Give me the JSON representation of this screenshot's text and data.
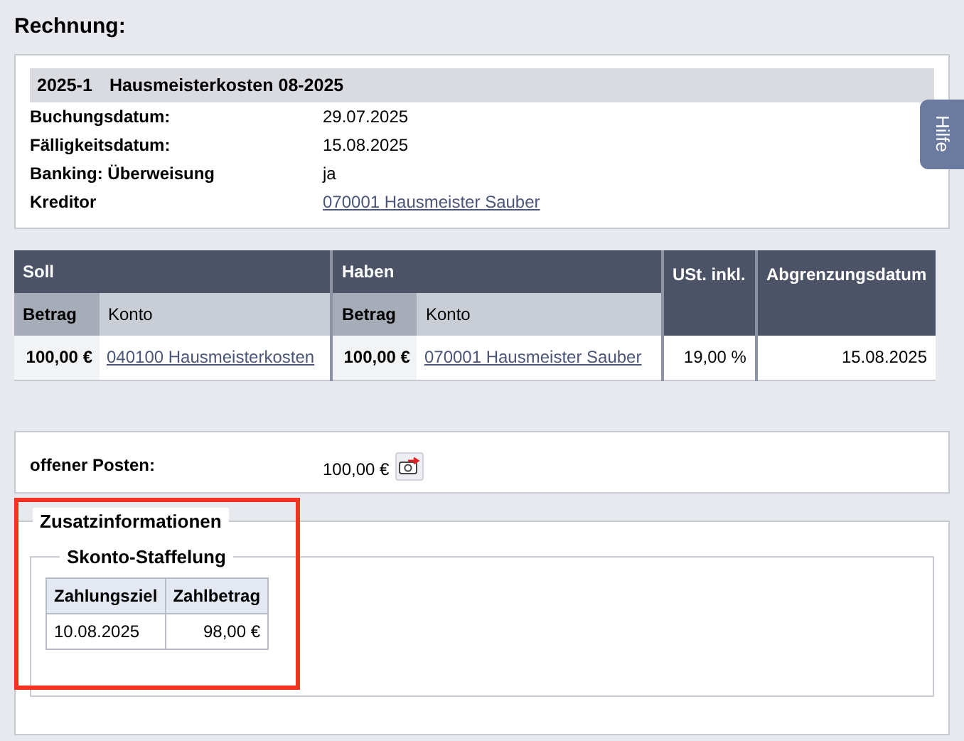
{
  "page_title": "Rechnung:",
  "invoice": {
    "title_number": "2025-1",
    "title_text": "Hausmeisterkosten 08-2025",
    "fields": [
      {
        "label": "Buchungsdatum:",
        "value": "29.07.2025",
        "kind": "text"
      },
      {
        "label": "Fälligkeitsdatum:",
        "value": "15.08.2025",
        "kind": "text"
      },
      {
        "label": "Banking: Überweisung",
        "value": "ja",
        "kind": "text"
      },
      {
        "label": "Kreditor",
        "value": "070001 Hausmeister Sauber",
        "kind": "link"
      }
    ]
  },
  "help_tab": "Hilfe",
  "booking_table": {
    "groups": [
      "Soll",
      "Haben",
      "USt. inkl.",
      "Abgrenzungsdatum"
    ],
    "subheaders": [
      "Betrag",
      "Konto",
      "Betrag",
      "Konto"
    ],
    "row": {
      "soll_betrag": "100,00 €",
      "soll_konto": "040100 Hausmeisterkosten",
      "haben_betrag": "100,00 €",
      "haben_konto": "070001 Hausmeister Sauber",
      "ust": "19,00 %",
      "abgrenzungsdatum": "15.08.2025"
    }
  },
  "open_item": {
    "label": "offener Posten:",
    "value": "100,00 €"
  },
  "additional_info": {
    "title": "Zusatzinformationen",
    "highlighted": true,
    "discount": {
      "title": "Skonto-Staffelung",
      "columns": [
        "Zahlungsziel",
        "Zahlbetrag"
      ],
      "rows": [
        [
          "10.08.2025",
          "98,00 €"
        ]
      ]
    }
  }
}
